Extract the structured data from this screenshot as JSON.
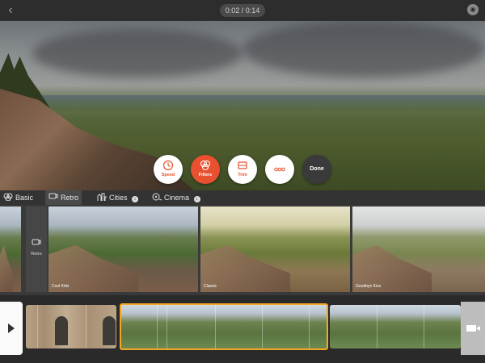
{
  "topbar": {
    "timecode": "0:02 / 0:14",
    "back_icon": "back-chevron-icon",
    "menu_icon": "camera-icon"
  },
  "tools": [
    {
      "label": "Speed",
      "icon": "speed-icon",
      "active": false
    },
    {
      "label": "Filters",
      "icon": "filters-icon",
      "active": true
    },
    {
      "label": "Trim",
      "icon": "trim-icon",
      "active": false
    },
    {
      "label": "",
      "icon": "more-icon",
      "active": false
    },
    {
      "label": "Done",
      "icon": "",
      "active": false
    }
  ],
  "categories": [
    {
      "label": "Basic",
      "icon": "basic-filter-icon"
    },
    {
      "label": "Retro",
      "icon": "retro-icon",
      "selected": true
    },
    {
      "label": "Cities",
      "icon": "cities-icon"
    },
    {
      "label": "Cinema",
      "icon": "cinema-icon"
    }
  ],
  "filters": [
    {
      "name": "Cool Kids"
    },
    {
      "name": "Classic"
    },
    {
      "name": "Goodbye Kiss"
    }
  ],
  "retro_tile_label": "Retro",
  "colors": {
    "accent": "#e8502f",
    "selection": "#f5a623"
  }
}
